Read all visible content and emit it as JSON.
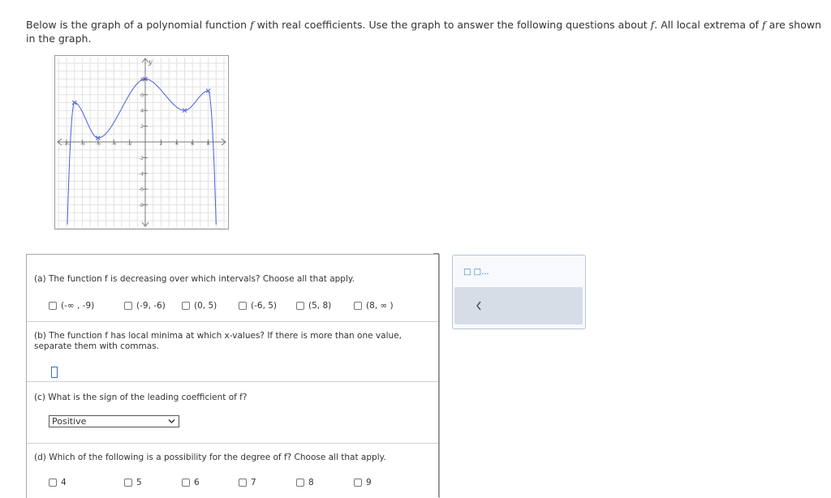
{
  "intro": {
    "part1": "Below is the graph of a polynomial function ",
    "f1": "f",
    "part2": " with real coefficients. Use the graph to answer the following questions about ",
    "f2": "f",
    "part3": ". All local extrema of ",
    "f3": "f",
    "part4": " are shown in the graph."
  },
  "graph": {
    "y_axis_label": "y",
    "x_ticks": [
      "-10",
      "-8",
      "-6",
      "-4",
      "-2",
      "2",
      "4",
      "6",
      "8"
    ],
    "y_ticks": [
      "8",
      "6",
      "4",
      "2",
      "-2",
      "-4",
      "-6",
      "-8"
    ],
    "curve_color": "#4a5fd8",
    "extrema": [
      {
        "x": -9,
        "y": 5
      },
      {
        "x": -6,
        "y": 0.5
      },
      {
        "x": 0,
        "y": 8
      },
      {
        "x": 5,
        "y": 4
      },
      {
        "x": 8,
        "y": 6.5
      }
    ]
  },
  "part_a": {
    "question": "(a) The function f is decreasing over which intervals? Choose all that apply.",
    "options": [
      "(-∞ , -9)",
      "(-9, -6)",
      "(0, 5)",
      "(-6, 5)",
      "(5, 8)",
      "(8, ∞ )"
    ]
  },
  "part_b": {
    "question_line1": "(b) The function f has local minima at which x-values? If there is more than one value,",
    "question_line2": "separate them with commas.",
    "answer": ""
  },
  "part_c": {
    "question": "(c) What is the sign of the leading coefficient of f?",
    "selected": "Positive"
  },
  "part_d": {
    "question": "(d) Which of the following is a possibility for the degree of f? Choose all that apply.",
    "options": [
      "4",
      "5",
      "6",
      "7",
      "8",
      "9"
    ]
  },
  "tool": {
    "icons_text": "□ □..."
  }
}
